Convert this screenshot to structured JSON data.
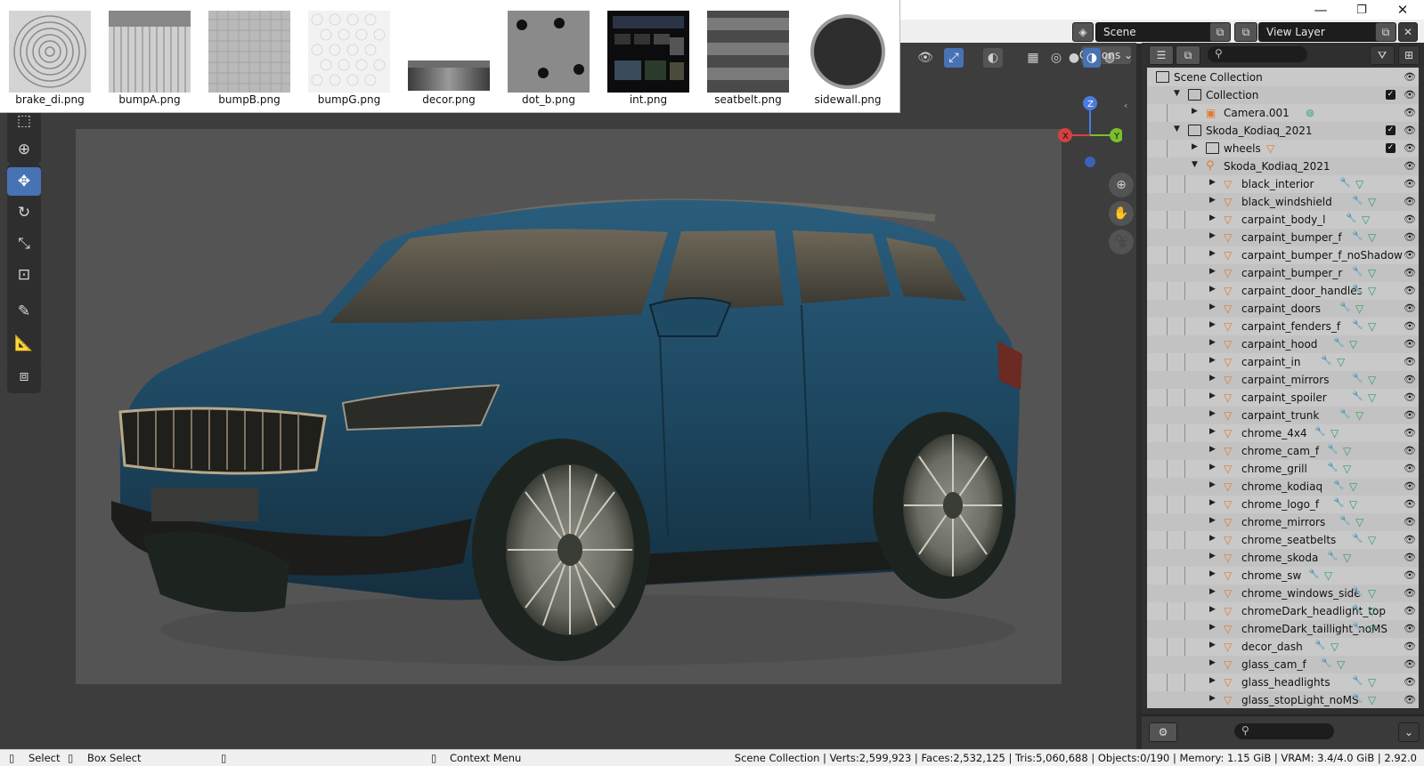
{
  "window": {
    "controls": [
      "—",
      "❐",
      "✕"
    ]
  },
  "top_header": {
    "scene_label": "Scene",
    "view_layer_label": "View Layer"
  },
  "viewport": {
    "options_label": "Options",
    "axes": {
      "x": "X",
      "y": "Y",
      "z": "Z"
    }
  },
  "image_browser": {
    "images": [
      {
        "name": "brake_di.png",
        "pattern": "rings"
      },
      {
        "name": "bumpA.png",
        "pattern": "vstripes"
      },
      {
        "name": "bumpB.png",
        "pattern": "grid"
      },
      {
        "name": "bumpG.png",
        "pattern": "hex"
      },
      {
        "name": "decor.png",
        "pattern": "gradient"
      },
      {
        "name": "dot_b.png",
        "pattern": "dots"
      },
      {
        "name": "int.png",
        "pattern": "dashboard"
      },
      {
        "name": "seatbelt.png",
        "pattern": "weave"
      },
      {
        "name": "sidewall.png",
        "pattern": "tire"
      }
    ]
  },
  "outliner": {
    "rows": [
      {
        "label": "Scene Collection",
        "depth": 0,
        "icon": "scene-collection",
        "expand": "",
        "check": false
      },
      {
        "label": "Collection",
        "depth": 1,
        "icon": "collection",
        "expand": "open",
        "check": true
      },
      {
        "label": "Camera.001",
        "depth": 2,
        "icon": "camera",
        "expand": "closed",
        "check": false,
        "extra": "camera-data"
      },
      {
        "label": "Skoda_Kodiaq_2021",
        "depth": 1,
        "icon": "collection",
        "expand": "open",
        "check": true
      },
      {
        "label": "wheels",
        "depth": 2,
        "icon": "collection",
        "expand": "closed",
        "check": true,
        "extra": "mesh-badge"
      },
      {
        "label": "Skoda_Kodiaq_2021",
        "depth": 2,
        "icon": "armature",
        "expand": "open",
        "check": false
      },
      {
        "label": "black_interior",
        "depth": 3,
        "icon": "mesh",
        "expand": "closed",
        "mods": true
      },
      {
        "label": "black_windshield",
        "depth": 3,
        "icon": "mesh",
        "expand": "closed",
        "mods": true
      },
      {
        "label": "carpaint_body_l",
        "depth": 3,
        "icon": "mesh",
        "expand": "closed",
        "mods": true
      },
      {
        "label": "carpaint_bumper_f",
        "depth": 3,
        "icon": "mesh",
        "expand": "closed",
        "mods": true
      },
      {
        "label": "carpaint_bumper_f_noShadow",
        "depth": 3,
        "icon": "mesh",
        "expand": "closed",
        "mods": false
      },
      {
        "label": "carpaint_bumper_r",
        "depth": 3,
        "icon": "mesh",
        "expand": "closed",
        "mods": true
      },
      {
        "label": "carpaint_door_handles",
        "depth": 3,
        "icon": "mesh",
        "expand": "closed",
        "mods": true
      },
      {
        "label": "carpaint_doors",
        "depth": 3,
        "icon": "mesh",
        "expand": "closed",
        "mods": true
      },
      {
        "label": "carpaint_fenders_f",
        "depth": 3,
        "icon": "mesh",
        "expand": "closed",
        "mods": true
      },
      {
        "label": "carpaint_hood",
        "depth": 3,
        "icon": "mesh",
        "expand": "closed",
        "mods": true
      },
      {
        "label": "carpaint_in",
        "depth": 3,
        "icon": "mesh",
        "expand": "closed",
        "mods": true
      },
      {
        "label": "carpaint_mirrors",
        "depth": 3,
        "icon": "mesh",
        "expand": "closed",
        "mods": true
      },
      {
        "label": "carpaint_spoiler",
        "depth": 3,
        "icon": "mesh",
        "expand": "closed",
        "mods": true
      },
      {
        "label": "carpaint_trunk",
        "depth": 3,
        "icon": "mesh",
        "expand": "closed",
        "mods": true
      },
      {
        "label": "chrome_4x4",
        "depth": 3,
        "icon": "mesh",
        "expand": "closed",
        "mods": true
      },
      {
        "label": "chrome_cam_f",
        "depth": 3,
        "icon": "mesh",
        "expand": "closed",
        "mods": true
      },
      {
        "label": "chrome_grill",
        "depth": 3,
        "icon": "mesh",
        "expand": "closed",
        "mods": true
      },
      {
        "label": "chrome_kodiaq",
        "depth": 3,
        "icon": "mesh",
        "expand": "closed",
        "mods": true
      },
      {
        "label": "chrome_logo_f",
        "depth": 3,
        "icon": "mesh",
        "expand": "closed",
        "mods": true
      },
      {
        "label": "chrome_mirrors",
        "depth": 3,
        "icon": "mesh",
        "expand": "closed",
        "mods": true
      },
      {
        "label": "chrome_seatbelts",
        "depth": 3,
        "icon": "mesh",
        "expand": "closed",
        "mods": true
      },
      {
        "label": "chrome_skoda",
        "depth": 3,
        "icon": "mesh",
        "expand": "closed",
        "mods": true
      },
      {
        "label": "chrome_sw",
        "depth": 3,
        "icon": "mesh",
        "expand": "closed",
        "mods": true
      },
      {
        "label": "chrome_windows_side",
        "depth": 3,
        "icon": "mesh",
        "expand": "closed",
        "mods": true
      },
      {
        "label": "chromeDark_headlight_top",
        "depth": 3,
        "icon": "mesh",
        "expand": "closed",
        "mods": true
      },
      {
        "label": "chromeDark_taillight_noMS",
        "depth": 3,
        "icon": "mesh",
        "expand": "closed",
        "mods": true
      },
      {
        "label": "decor_dash",
        "depth": 3,
        "icon": "mesh",
        "expand": "closed",
        "mods": true
      },
      {
        "label": "glass_cam_f",
        "depth": 3,
        "icon": "mesh",
        "expand": "closed",
        "mods": true
      },
      {
        "label": "glass_headlights",
        "depth": 3,
        "icon": "mesh",
        "expand": "closed",
        "mods": true
      },
      {
        "label": "glass_stopLight_noMS",
        "depth": 3,
        "icon": "mesh",
        "expand": "closed",
        "mods": true
      }
    ]
  },
  "statusbar": {
    "select": "Select",
    "box_select": "Box Select",
    "context_menu": "Context Menu",
    "stats": "Scene Collection | Verts:2,599,923 | Faces:2,532,125 | Tris:5,060,688 | Objects:0/190 | Memory: 1.15 GiB | VRAM: 3.4/4.0 GiB | 2.92.0"
  },
  "colors": {
    "accent": "#4772b3",
    "mesh_icon": "#e0792c",
    "material_icon": "#2e9a74",
    "modifier_icon": "#3b62c8",
    "car_body": "#1f4a64"
  }
}
